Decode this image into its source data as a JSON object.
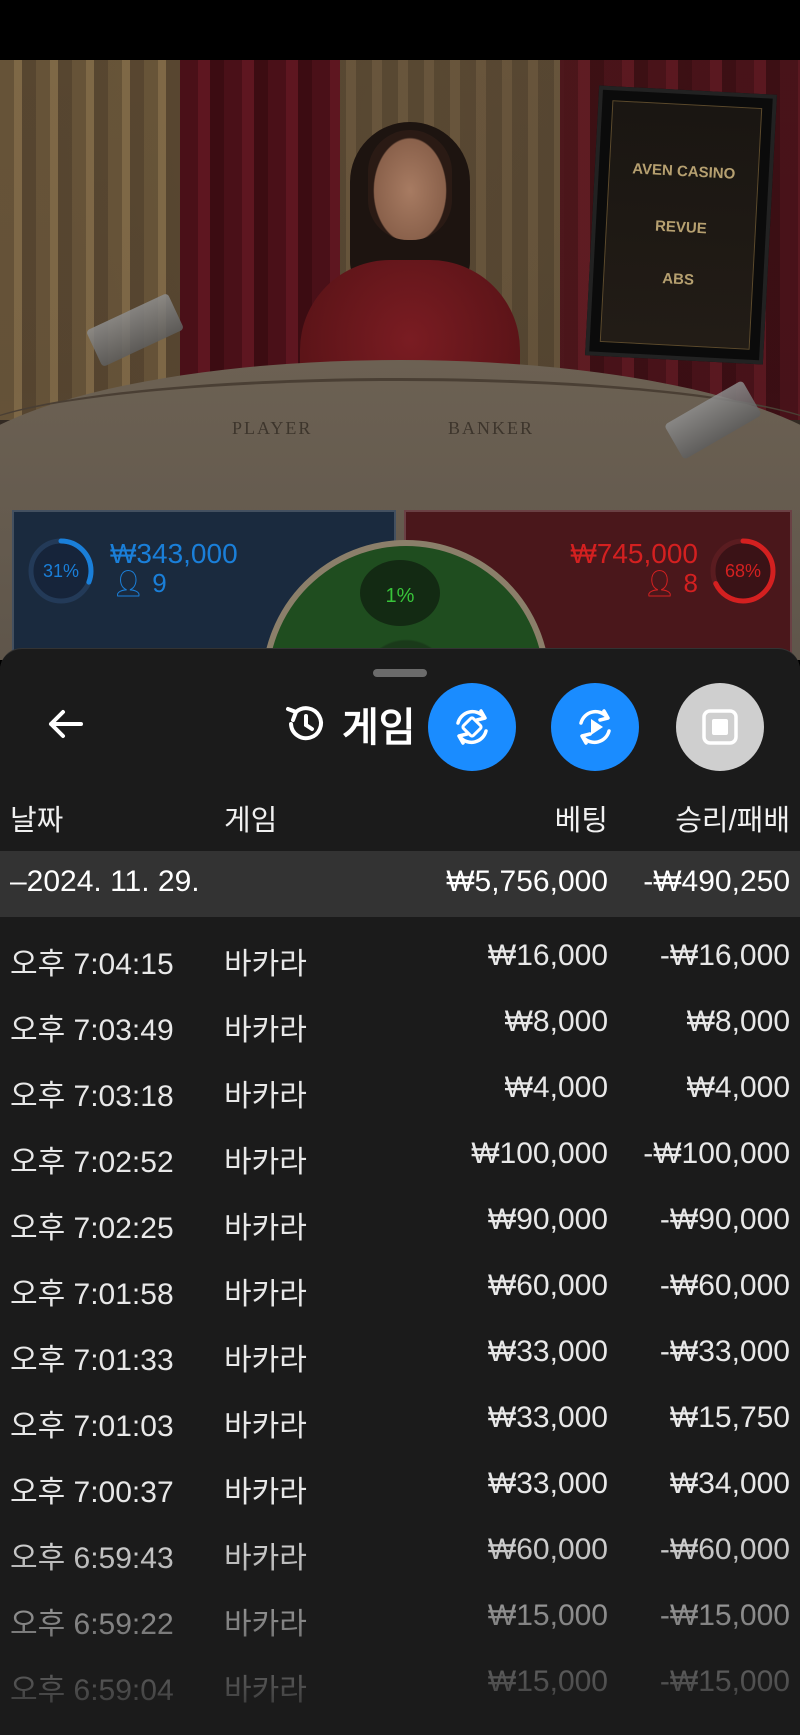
{
  "video": {
    "table_labels": [
      "PLAYER",
      "BANKER"
    ],
    "monitor_brands": [
      "AVEN CASINO",
      "REVUE",
      "ABS"
    ]
  },
  "betting": {
    "player": {
      "percent": "31%",
      "percent_value": 31,
      "amount": "₩343,000",
      "players": "9",
      "color": "#1a7fd9"
    },
    "tie": {
      "percent": "1%",
      "percent_value": 1,
      "color": "#38c43a"
    },
    "banker": {
      "percent": "68%",
      "percent_value": 68,
      "amount": "₩745,000",
      "players": "8",
      "color": "#d42020"
    }
  },
  "history": {
    "title": "게임",
    "columns": {
      "date": "날짜",
      "game": "게임",
      "bet": "베팅",
      "winloss": "승리/패배"
    },
    "date_group": {
      "label": "–2024. 11. 29.",
      "bet_total": "₩5,756,000",
      "winloss_total": "-₩490,250"
    },
    "rows": [
      {
        "time": "오후 7:04:15",
        "game": "바카라",
        "bet": "₩16,000",
        "result": "-₩16,000"
      },
      {
        "time": "오후 7:03:49",
        "game": "바카라",
        "bet": "₩8,000",
        "result": "₩8,000"
      },
      {
        "time": "오후 7:03:18",
        "game": "바카라",
        "bet": "₩4,000",
        "result": "₩4,000"
      },
      {
        "time": "오후 7:02:52",
        "game": "바카라",
        "bet": "₩100,000",
        "result": "-₩100,000"
      },
      {
        "time": "오후 7:02:25",
        "game": "바카라",
        "bet": "₩90,000",
        "result": "-₩90,000"
      },
      {
        "time": "오후 7:01:58",
        "game": "바카라",
        "bet": "₩60,000",
        "result": "-₩60,000"
      },
      {
        "time": "오후 7:01:33",
        "game": "바카라",
        "bet": "₩33,000",
        "result": "-₩33,000"
      },
      {
        "time": "오후 7:01:03",
        "game": "바카라",
        "bet": "₩33,000",
        "result": "₩15,750"
      },
      {
        "time": "오후 7:00:37",
        "game": "바카라",
        "bet": "₩33,000",
        "result": "₩34,000"
      },
      {
        "time": "오후 6:59:43",
        "game": "바카라",
        "bet": "₩60,000",
        "result": "-₩60,000"
      },
      {
        "time": "오후 6:59:22",
        "game": "바카라",
        "bet": "₩15,000",
        "result": "-₩15,000"
      },
      {
        "time": "오후 6:59:04",
        "game": "바카라",
        "bet": "₩15,000",
        "result": "-₩15,000"
      }
    ]
  },
  "icons": {
    "back": "arrow-left-icon",
    "history": "history-clock-icon",
    "sync": "sync-icon",
    "replay": "replay-icon",
    "stop": "stop-icon"
  }
}
